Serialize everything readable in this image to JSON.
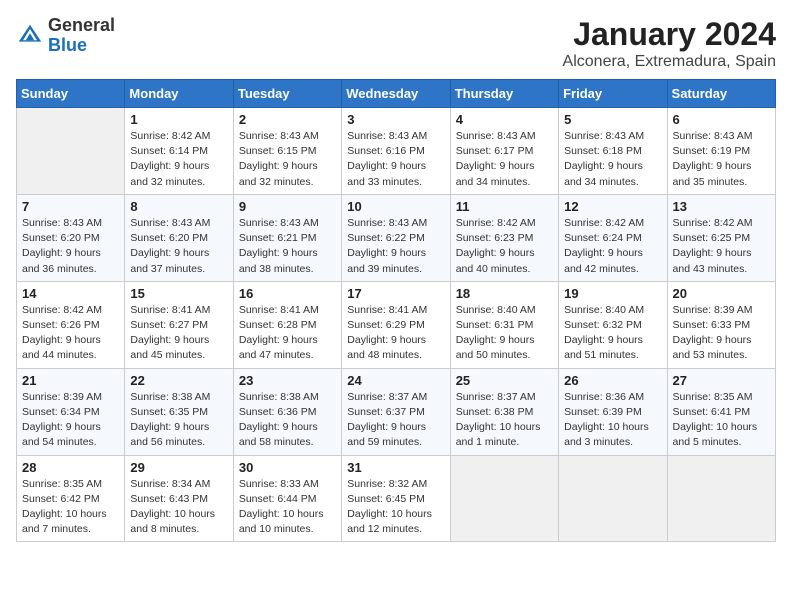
{
  "logo": {
    "general": "General",
    "blue": "Blue"
  },
  "title": "January 2024",
  "subtitle": "Alconera, Extremadura, Spain",
  "days_of_week": [
    "Sunday",
    "Monday",
    "Tuesday",
    "Wednesday",
    "Thursday",
    "Friday",
    "Saturday"
  ],
  "weeks": [
    [
      {
        "day": "",
        "info": ""
      },
      {
        "day": "1",
        "info": "Sunrise: 8:42 AM\nSunset: 6:14 PM\nDaylight: 9 hours\nand 32 minutes."
      },
      {
        "day": "2",
        "info": "Sunrise: 8:43 AM\nSunset: 6:15 PM\nDaylight: 9 hours\nand 32 minutes."
      },
      {
        "day": "3",
        "info": "Sunrise: 8:43 AM\nSunset: 6:16 PM\nDaylight: 9 hours\nand 33 minutes."
      },
      {
        "day": "4",
        "info": "Sunrise: 8:43 AM\nSunset: 6:17 PM\nDaylight: 9 hours\nand 34 minutes."
      },
      {
        "day": "5",
        "info": "Sunrise: 8:43 AM\nSunset: 6:18 PM\nDaylight: 9 hours\nand 34 minutes."
      },
      {
        "day": "6",
        "info": "Sunrise: 8:43 AM\nSunset: 6:19 PM\nDaylight: 9 hours\nand 35 minutes."
      }
    ],
    [
      {
        "day": "7",
        "info": "Sunrise: 8:43 AM\nSunset: 6:20 PM\nDaylight: 9 hours\nand 36 minutes."
      },
      {
        "day": "8",
        "info": "Sunrise: 8:43 AM\nSunset: 6:20 PM\nDaylight: 9 hours\nand 37 minutes."
      },
      {
        "day": "9",
        "info": "Sunrise: 8:43 AM\nSunset: 6:21 PM\nDaylight: 9 hours\nand 38 minutes."
      },
      {
        "day": "10",
        "info": "Sunrise: 8:43 AM\nSunset: 6:22 PM\nDaylight: 9 hours\nand 39 minutes."
      },
      {
        "day": "11",
        "info": "Sunrise: 8:42 AM\nSunset: 6:23 PM\nDaylight: 9 hours\nand 40 minutes."
      },
      {
        "day": "12",
        "info": "Sunrise: 8:42 AM\nSunset: 6:24 PM\nDaylight: 9 hours\nand 42 minutes."
      },
      {
        "day": "13",
        "info": "Sunrise: 8:42 AM\nSunset: 6:25 PM\nDaylight: 9 hours\nand 43 minutes."
      }
    ],
    [
      {
        "day": "14",
        "info": "Sunrise: 8:42 AM\nSunset: 6:26 PM\nDaylight: 9 hours\nand 44 minutes."
      },
      {
        "day": "15",
        "info": "Sunrise: 8:41 AM\nSunset: 6:27 PM\nDaylight: 9 hours\nand 45 minutes."
      },
      {
        "day": "16",
        "info": "Sunrise: 8:41 AM\nSunset: 6:28 PM\nDaylight: 9 hours\nand 47 minutes."
      },
      {
        "day": "17",
        "info": "Sunrise: 8:41 AM\nSunset: 6:29 PM\nDaylight: 9 hours\nand 48 minutes."
      },
      {
        "day": "18",
        "info": "Sunrise: 8:40 AM\nSunset: 6:31 PM\nDaylight: 9 hours\nand 50 minutes."
      },
      {
        "day": "19",
        "info": "Sunrise: 8:40 AM\nSunset: 6:32 PM\nDaylight: 9 hours\nand 51 minutes."
      },
      {
        "day": "20",
        "info": "Sunrise: 8:39 AM\nSunset: 6:33 PM\nDaylight: 9 hours\nand 53 minutes."
      }
    ],
    [
      {
        "day": "21",
        "info": "Sunrise: 8:39 AM\nSunset: 6:34 PM\nDaylight: 9 hours\nand 54 minutes."
      },
      {
        "day": "22",
        "info": "Sunrise: 8:38 AM\nSunset: 6:35 PM\nDaylight: 9 hours\nand 56 minutes."
      },
      {
        "day": "23",
        "info": "Sunrise: 8:38 AM\nSunset: 6:36 PM\nDaylight: 9 hours\nand 58 minutes."
      },
      {
        "day": "24",
        "info": "Sunrise: 8:37 AM\nSunset: 6:37 PM\nDaylight: 9 hours\nand 59 minutes."
      },
      {
        "day": "25",
        "info": "Sunrise: 8:37 AM\nSunset: 6:38 PM\nDaylight: 10 hours\nand 1 minute."
      },
      {
        "day": "26",
        "info": "Sunrise: 8:36 AM\nSunset: 6:39 PM\nDaylight: 10 hours\nand 3 minutes."
      },
      {
        "day": "27",
        "info": "Sunrise: 8:35 AM\nSunset: 6:41 PM\nDaylight: 10 hours\nand 5 minutes."
      }
    ],
    [
      {
        "day": "28",
        "info": "Sunrise: 8:35 AM\nSunset: 6:42 PM\nDaylight: 10 hours\nand 7 minutes."
      },
      {
        "day": "29",
        "info": "Sunrise: 8:34 AM\nSunset: 6:43 PM\nDaylight: 10 hours\nand 8 minutes."
      },
      {
        "day": "30",
        "info": "Sunrise: 8:33 AM\nSunset: 6:44 PM\nDaylight: 10 hours\nand 10 minutes."
      },
      {
        "day": "31",
        "info": "Sunrise: 8:32 AM\nSunset: 6:45 PM\nDaylight: 10 hours\nand 12 minutes."
      },
      {
        "day": "",
        "info": ""
      },
      {
        "day": "",
        "info": ""
      },
      {
        "day": "",
        "info": ""
      }
    ]
  ]
}
